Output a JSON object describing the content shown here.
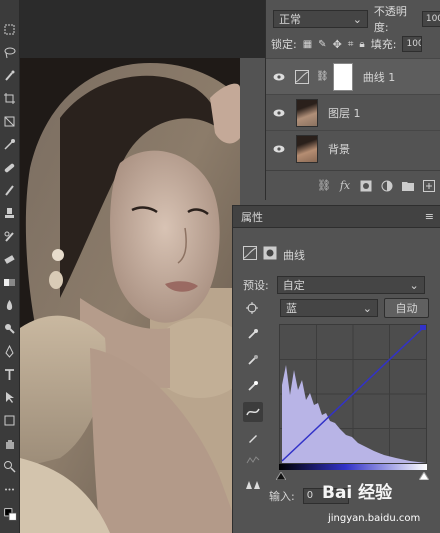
{
  "layers_panel": {
    "blend_mode": "正常",
    "opacity_label": "不透明度:",
    "opacity_value": "100",
    "lock_label": "锁定:",
    "fill_label": "填充:",
    "fill_value": "100",
    "layers": [
      {
        "name": "曲线 1",
        "thumb": "curves-adjustment-icon",
        "mask": true
      },
      {
        "name": "图层 1",
        "thumb": "photo-thumbnail"
      },
      {
        "name": "背景",
        "thumb": "photo-thumbnail"
      }
    ],
    "bottom_icons": [
      "link-icon",
      "fx-icon",
      "add-mask-icon",
      "adjustment-layer-icon",
      "group-folder-icon",
      "new-layer-icon",
      "trash-icon"
    ]
  },
  "properties_panel": {
    "title": "属性",
    "adjustment_name": "曲线",
    "preset_label": "预设:",
    "preset_value": "自定",
    "channel_value": "蓝",
    "auto_button": "自动",
    "input_label": "输入:",
    "input_value": "0",
    "tools": [
      "target-adjust-icon",
      "black-eyedropper-icon",
      "gray-eyedropper-icon",
      "white-eyedropper-icon",
      "curve-point-tool-icon",
      "pencil-draw-icon",
      "smooth-icon",
      "clipping-warning-icon"
    ]
  },
  "watermark": {
    "brand": "Bai 经验",
    "url": "jingyan.baidu.com"
  },
  "colors": {
    "panel": "#535353",
    "dark": "#2b2b2b",
    "curve": "#3232c8",
    "histogram": "#b8b4e6"
  }
}
